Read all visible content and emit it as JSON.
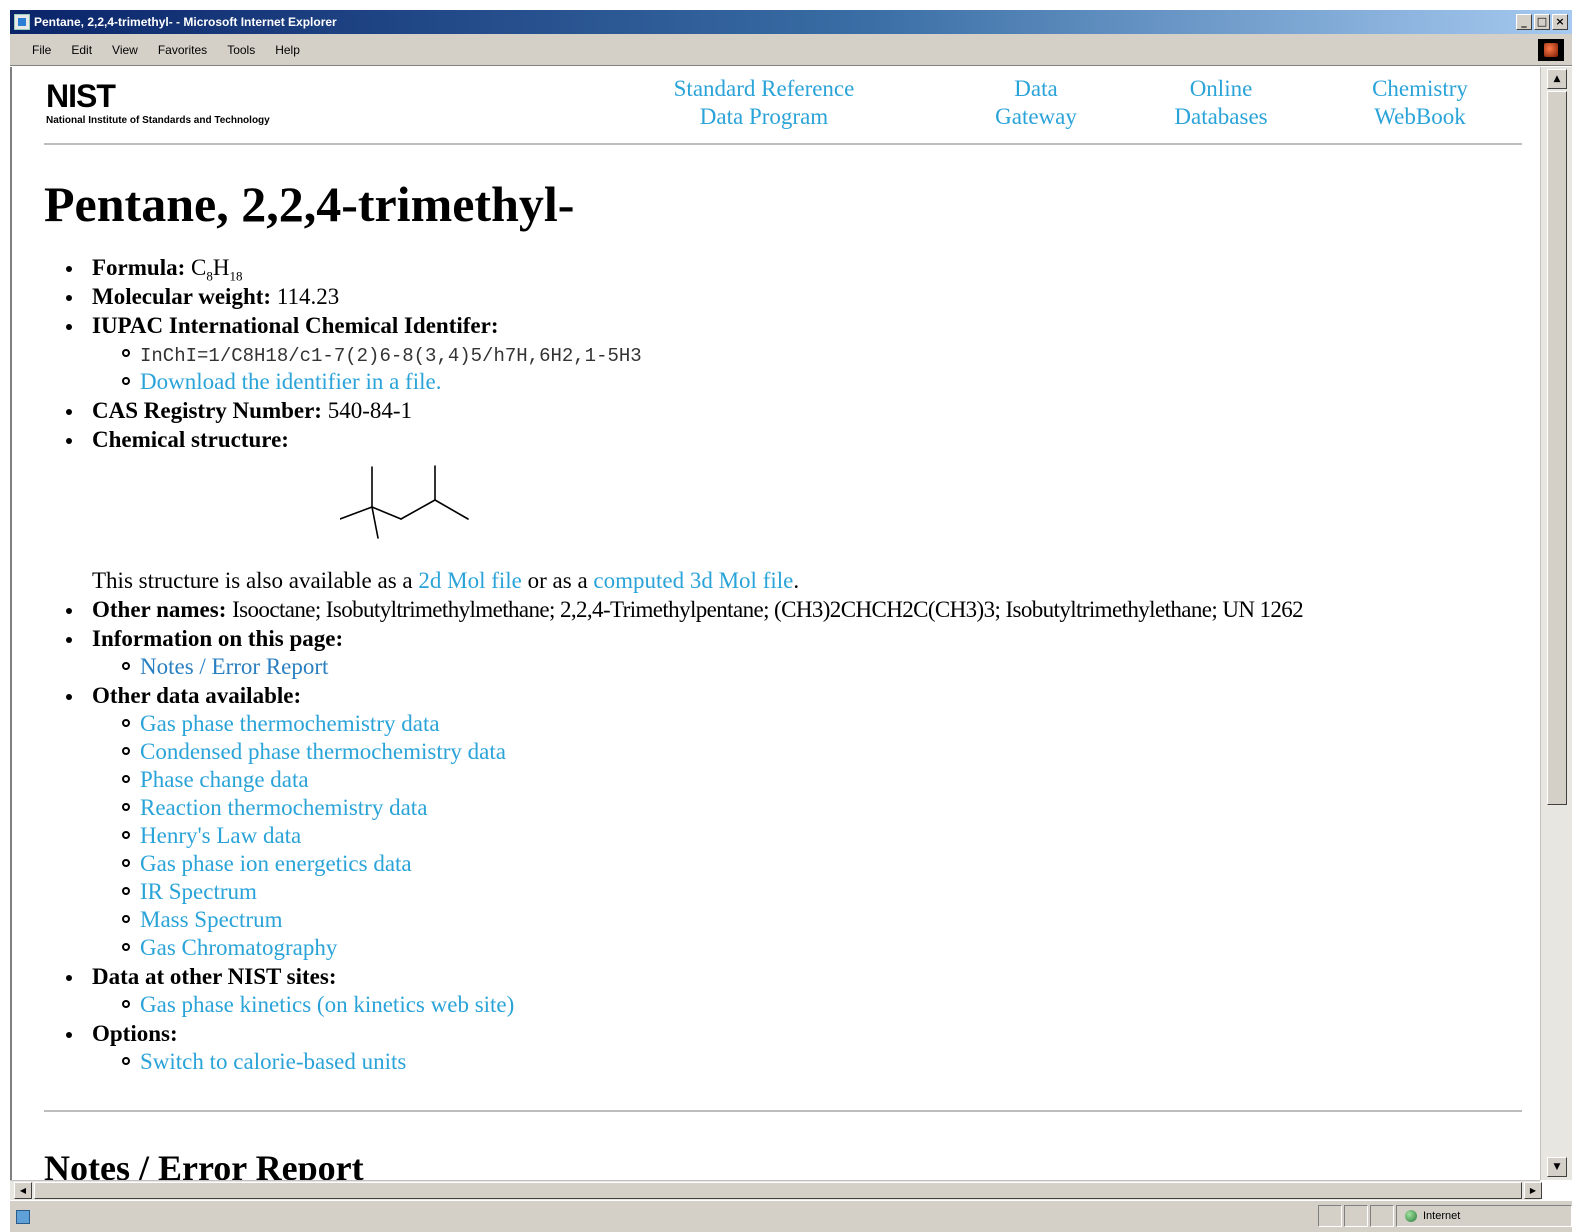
{
  "window": {
    "title": "Pentane, 2,2,4-trimethyl- - Microsoft Internet Explorer",
    "buttons": {
      "minimize": "_",
      "maximize": "□",
      "close": "×"
    }
  },
  "menubar": {
    "items": [
      "File",
      "Edit",
      "View",
      "Favorites",
      "Tools",
      "Help"
    ]
  },
  "header": {
    "logo_text": "NIST",
    "logo_subtitle": "National Institute of Standards and Technology",
    "nav": [
      {
        "line1": "Standard Reference",
        "line2": "Data Program"
      },
      {
        "line1": "Data",
        "line2": "Gateway"
      },
      {
        "line1": "Online",
        "line2": "Databases"
      },
      {
        "line1": "Chemistry",
        "line2": "WebBook"
      }
    ]
  },
  "page": {
    "title": "Pentane, 2,2,4-trimethyl-",
    "formula_label": "Formula:",
    "formula": {
      "c": "C",
      "c_sub": "8",
      "h": "H",
      "h_sub": "18"
    },
    "mw_label": "Molecular weight:",
    "mw_value": "114.23",
    "iupac_label": "IUPAC International Chemical Identifer:",
    "inchi": "InChI=1/C8H18/c1-7(2)6-8(3,4)5/h7H,6H2,1-5H3",
    "download_link": "Download the identifier in a file.",
    "cas_label": "CAS Registry Number:",
    "cas_value": "540-84-1",
    "structure_label": "Chemical structure:",
    "structure_note_a": "This structure is also available as a ",
    "structure_link_2d": "2d Mol file",
    "structure_note_b": " or as a ",
    "structure_link_3d": "computed 3d Mol file",
    "structure_note_c": ".",
    "other_names_label": "Other names:",
    "other_names": "Isooctane; Isobutyltrimethylmethane; 2,2,4-Trimethylpentane; (CH3)2CHCH2C(CH3)3; Isobutyltrimethylethane; UN 1262",
    "info_label": "Information on this page:",
    "info_links": [
      "Notes / Error Report"
    ],
    "other_data_label": "Other data available:",
    "other_data_links": [
      "Gas phase thermochemistry data",
      "Condensed phase thermochemistry data",
      "Phase change data",
      "Reaction thermochemistry data",
      "Henry's Law data",
      "Gas phase ion energetics data",
      "IR Spectrum",
      "Mass Spectrum",
      "Gas Chromatography"
    ],
    "other_sites_label": "Data at other NIST sites:",
    "other_sites_links": [
      "Gas phase kinetics (on kinetics web site)"
    ],
    "options_label": "Options:",
    "options_links": [
      "Switch to calorie-based units"
    ],
    "notes_heading": "Notes / Error Report"
  },
  "statusbar": {
    "zone": "Internet"
  },
  "colors": {
    "link": "#2aa3d8",
    "titlebar_start": "#0a246a",
    "chrome": "#d4d0c8"
  }
}
